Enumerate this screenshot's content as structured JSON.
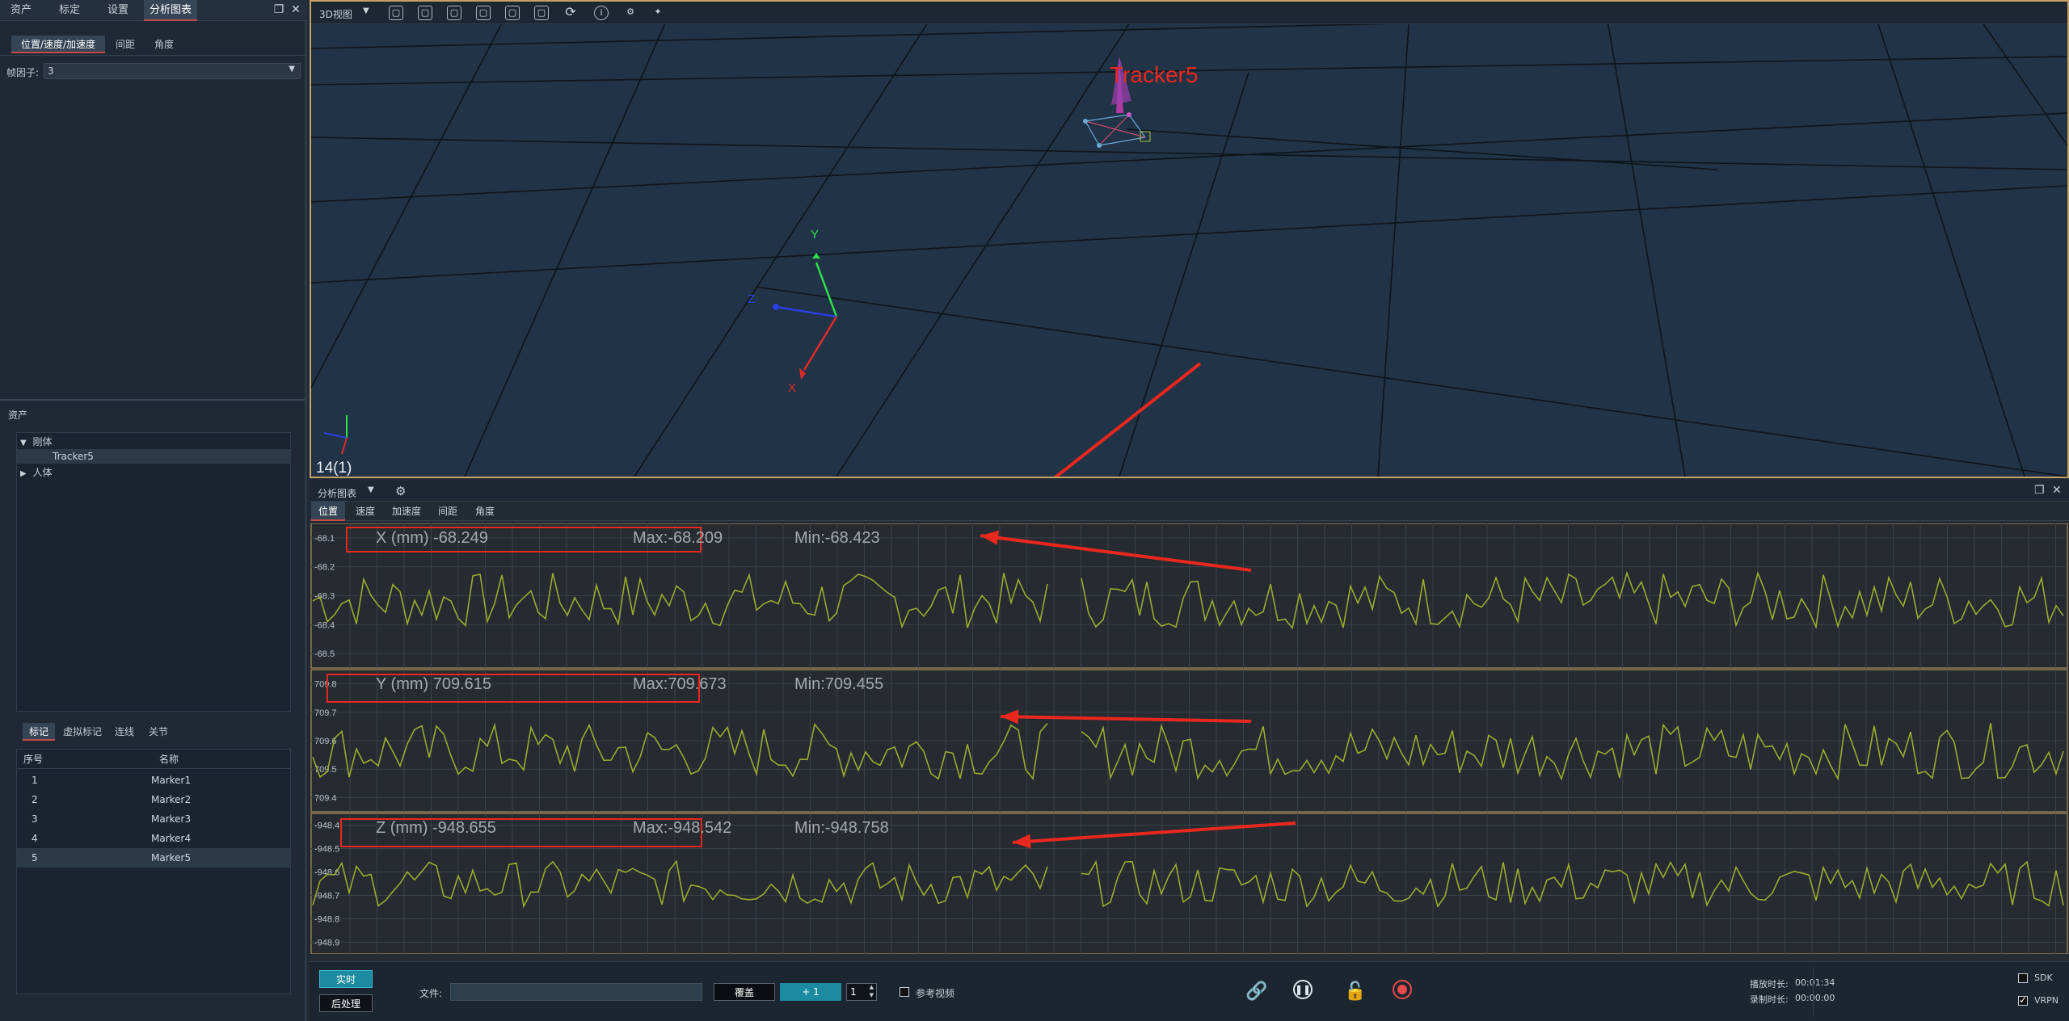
{
  "left_panel": {
    "tabs": [
      "资产",
      "标定",
      "设置",
      "分析图表"
    ],
    "active_tab": 3,
    "subtabs": [
      "位置/速度/加速度",
      "间距",
      "角度"
    ],
    "active_subtab": 0,
    "frame_factor_label": "帧因子:",
    "frame_factor_value": "3",
    "assets_title": "资产",
    "tree": {
      "rigid_label": "刚体",
      "rigid_child": "Tracker5",
      "human_label": "人体"
    },
    "marker_tabs": [
      "标记",
      "虚拟标记",
      "连线",
      "关节"
    ],
    "marker_headers": [
      "序号",
      "名称"
    ],
    "markers": [
      {
        "idx": "1",
        "name": "Marker1"
      },
      {
        "idx": "2",
        "name": "Marker2"
      },
      {
        "idx": "3",
        "name": "Marker3"
      },
      {
        "idx": "4",
        "name": "Marker4"
      },
      {
        "idx": "5",
        "name": "Marker5"
      }
    ]
  },
  "view3d": {
    "title": "3D视图",
    "tracker_label": "Tracker5",
    "frame_info": "14(1)",
    "axis_y": "Y",
    "axis_z": "Z",
    "axis_x": "X"
  },
  "analysis": {
    "title": "分析图表",
    "tabs": [
      "位置",
      "速度",
      "加速度",
      "间距",
      "角度"
    ],
    "active_tab": 0,
    "charts": [
      {
        "label": "X (mm) -68.249",
        "max": "Max:-68.209",
        "min": "Min:-68.423",
        "ticks": [
          "-68.1",
          "-68.2",
          "-68.3",
          "-68.4",
          "-68.5"
        ]
      },
      {
        "label": "Y (mm) 709.615",
        "max": "Max:709.673",
        "min": "Min:709.455",
        "ticks": [
          "709.8",
          "709.7",
          "709.6",
          "709.5",
          "709.4"
        ]
      },
      {
        "label": "Z (mm) -948.655",
        "max": "Max:-948.542",
        "min": "Min:-948.758",
        "ticks": [
          "-948.4",
          "-948.5",
          "-948.6",
          "-948.7",
          "-948.8",
          "-948.9"
        ]
      }
    ]
  },
  "bottom": {
    "realtime": "实时",
    "postprocess": "后处理",
    "file_label": "文件:",
    "file_value": "",
    "overwrite": "覆盖",
    "plus_one": "+ 1",
    "spin_value": "1",
    "ref_video": "参考视频",
    "play_duration_label": "播放时长:",
    "play_duration": "00:01:34",
    "record_duration_label": "录制时长:",
    "record_duration": "00:00:00",
    "sdk": "SDK",
    "vrpn": "VRPN"
  },
  "colors": {
    "accent": "#c44b4b",
    "signal": "#9aab2e",
    "annotation": "#e8281e"
  },
  "chart_data": [
    {
      "type": "line",
      "title": "X (mm) -68.249",
      "ylim": [
        -68.55,
        -68.05
      ],
      "max": -68.209,
      "min": -68.423
    },
    {
      "type": "line",
      "title": "Y (mm) 709.615",
      "ylim": [
        709.35,
        709.85
      ],
      "max": 709.673,
      "min": 709.455
    },
    {
      "type": "line",
      "title": "Z (mm) -948.655",
      "ylim": [
        -948.95,
        -948.35
      ],
      "max": -948.542,
      "min": -948.758
    }
  ]
}
